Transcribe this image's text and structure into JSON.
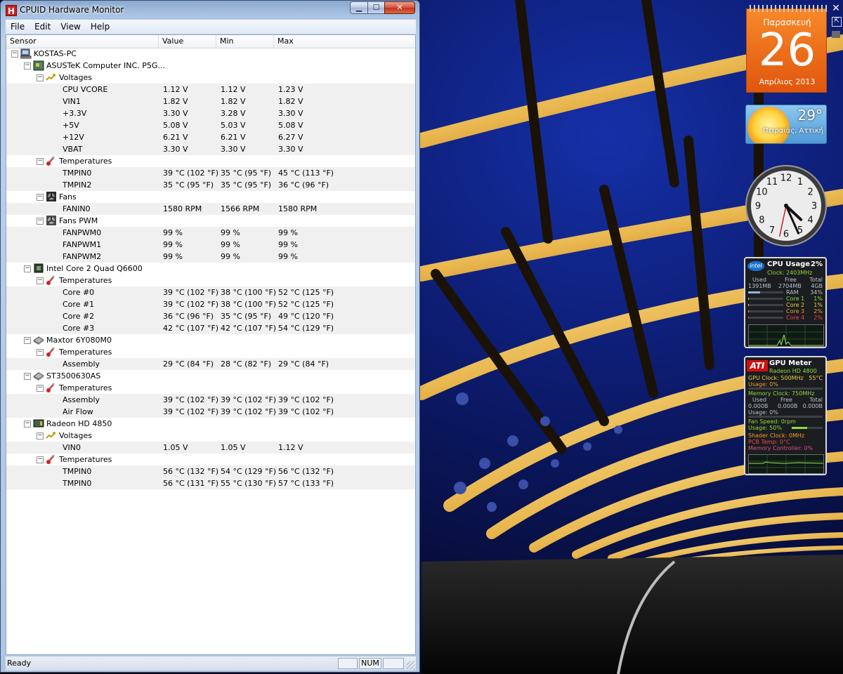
{
  "window": {
    "title": "CPUID Hardware Monitor",
    "app_icon_letter": "H",
    "min_symbol": "▁",
    "max_symbol": "☐",
    "close_symbol": "✕"
  },
  "menu": [
    "File",
    "Edit",
    "View",
    "Help"
  ],
  "columns": [
    "Sensor",
    "Value",
    "Min",
    "Max"
  ],
  "tree": [
    {
      "level": 0,
      "type": "pc",
      "label": "KOSTAS-PC",
      "expand": "minus"
    },
    {
      "level": 1,
      "type": "board",
      "label": "ASUSTeK Computer INC. P5G...",
      "expand": "minus"
    },
    {
      "level": 2,
      "type": "voltage",
      "label": "Voltages",
      "expand": "minus"
    },
    {
      "level": 3,
      "label": "CPU VCORE",
      "value": "1.12 V",
      "min": "1.12 V",
      "max": "1.23 V"
    },
    {
      "level": 3,
      "label": "VIN1",
      "value": "1.82 V",
      "min": "1.82 V",
      "max": "1.82 V"
    },
    {
      "level": 3,
      "label": "+3.3V",
      "value": "3.30 V",
      "min": "3.28 V",
      "max": "3.30 V"
    },
    {
      "level": 3,
      "label": "+5V",
      "value": "5.08 V",
      "min": "5.03 V",
      "max": "5.08 V"
    },
    {
      "level": 3,
      "label": "+12V",
      "value": "6.21 V",
      "min": "6.21 V",
      "max": "6.27 V"
    },
    {
      "level": 3,
      "label": "VBAT",
      "value": "3.30 V",
      "min": "3.30 V",
      "max": "3.30 V"
    },
    {
      "level": 2,
      "type": "temp",
      "label": "Temperatures",
      "expand": "minus"
    },
    {
      "level": 3,
      "label": "TMPIN0",
      "value": "39 °C  (102 °F)",
      "min": "35 °C  (95 °F)",
      "max": "45 °C  (113 °F)"
    },
    {
      "level": 3,
      "label": "TMPIN2",
      "value": "35 °C  (95 °F)",
      "min": "35 °C  (95 °F)",
      "max": "36 °C  (96 °F)"
    },
    {
      "level": 2,
      "type": "fan",
      "label": "Fans",
      "expand": "minus"
    },
    {
      "level": 3,
      "label": "FANIN0",
      "value": "1580 RPM",
      "min": "1566 RPM",
      "max": "1580 RPM"
    },
    {
      "level": 2,
      "type": "fanpwm",
      "label": "Fans PWM",
      "expand": "minus"
    },
    {
      "level": 3,
      "label": "FANPWM0",
      "value": "99 %",
      "min": "99 %",
      "max": "99 %"
    },
    {
      "level": 3,
      "label": "FANPWM1",
      "value": "99 %",
      "min": "99 %",
      "max": "99 %"
    },
    {
      "level": 3,
      "label": "FANPWM2",
      "value": "99 %",
      "min": "99 %",
      "max": "99 %"
    },
    {
      "level": 1,
      "type": "cpu",
      "label": "Intel Core 2 Quad Q6600",
      "expand": "minus"
    },
    {
      "level": 2,
      "type": "temp",
      "label": "Temperatures",
      "expand": "minus"
    },
    {
      "level": 3,
      "label": "Core #0",
      "value": "39 °C  (102 °F)",
      "min": "38 °C  (100 °F)",
      "max": "52 °C  (125 °F)"
    },
    {
      "level": 3,
      "label": "Core #1",
      "value": "39 °C  (102 °F)",
      "min": "38 °C  (100 °F)",
      "max": "52 °C  (125 °F)"
    },
    {
      "level": 3,
      "label": "Core #2",
      "value": "36 °C  (96 °F)",
      "min": "35 °C  (95 °F)",
      "max": "49 °C  (120 °F)"
    },
    {
      "level": 3,
      "label": "Core #3",
      "value": "42 °C  (107 °F)",
      "min": "42 °C  (107 °F)",
      "max": "54 °C  (129 °F)"
    },
    {
      "level": 1,
      "type": "hdd",
      "label": "Maxtor 6Y080M0",
      "expand": "minus"
    },
    {
      "level": 2,
      "type": "temp",
      "label": "Temperatures",
      "expand": "minus"
    },
    {
      "level": 3,
      "label": "Assembly",
      "value": "29 °C  (84 °F)",
      "min": "28 °C  (82 °F)",
      "max": "29 °C  (84 °F)"
    },
    {
      "level": 1,
      "type": "hdd",
      "label": "ST3500630AS",
      "expand": "minus"
    },
    {
      "level": 2,
      "type": "temp",
      "label": "Temperatures",
      "expand": "minus"
    },
    {
      "level": 3,
      "label": "Assembly",
      "value": "39 °C  (102 °F)",
      "min": "39 °C  (102 °F)",
      "max": "39 °C  (102 °F)"
    },
    {
      "level": 3,
      "label": "Air Flow",
      "value": "39 °C  (102 °F)",
      "min": "39 °C  (102 °F)",
      "max": "39 °C  (102 °F)"
    },
    {
      "level": 1,
      "type": "gpu",
      "label": "Radeon HD 4850",
      "expand": "minus"
    },
    {
      "level": 2,
      "type": "voltage",
      "label": "Voltages",
      "expand": "minus"
    },
    {
      "level": 3,
      "label": "VIN0",
      "value": "1.05 V",
      "min": "1.05 V",
      "max": "1.12 V"
    },
    {
      "level": 2,
      "type": "temp",
      "label": "Temperatures",
      "expand": "minus"
    },
    {
      "level": 3,
      "label": "TMPIN0",
      "value": "56 °C  (132 °F)",
      "min": "54 °C  (129 °F)",
      "max": "56 °C  (132 °F)"
    },
    {
      "level": 3,
      "label": "TMPIN0",
      "value": "56 °C  (131 °F)",
      "min": "55 °C  (130 °F)",
      "max": "57 °C  (133 °F)"
    }
  ],
  "status": {
    "text": "Ready",
    "num": "NUM"
  },
  "gadgets": {
    "close_symbol": "✕",
    "tools_symbol": "⇱",
    "calendar": {
      "day_name": "Παρασκευή",
      "day": "26",
      "month_year": "Απρίλιος 2013"
    },
    "weather": {
      "temp": "29°",
      "location": "Πειραιάς, Αττική"
    },
    "clock": {
      "numerals": [
        "12",
        "1",
        "2",
        "3",
        "4",
        "5",
        "6",
        "7",
        "8",
        "9",
        "10",
        "11"
      ],
      "hour": 4,
      "minute": 26,
      "second": 32
    },
    "cpu": {
      "logo": "intel",
      "title": "CPU Usage",
      "percent": "2%",
      "clock": "Clock: 2403MHz",
      "headers": [
        "Used",
        "Free",
        "Total"
      ],
      "mem": [
        "1391MB",
        "2704MB",
        "4GB"
      ],
      "ram_label": "RAM",
      "ram_pct": "34%",
      "ram_fill": 0.34,
      "cores": [
        {
          "name": "Core 1",
          "pct": "1%",
          "fill": 0.01
        },
        {
          "name": "Core 2",
          "pct": "1%",
          "fill": 0.01
        },
        {
          "name": "Core 3",
          "pct": "2%",
          "fill": 0.02
        },
        {
          "name": "Core 4",
          "pct": "2%",
          "fill": 0.02
        }
      ],
      "colors": {
        "core1": "#8fdc3c",
        "core2": "#e8d23a",
        "core3": "#f2a12e",
        "core4": "#ee4a4a"
      }
    },
    "gpu": {
      "logo": "ATI",
      "title": "GPU Meter",
      "model": "Radeon HD 4800",
      "gpu_clock": "GPU Clock: 500MHz",
      "gpu_temp": "55°C",
      "gpu_usage": "Usage: 0%",
      "mem_clock": "Memory Clock: 750MHz",
      "headers": [
        "Used",
        "Free",
        "Total"
      ],
      "mem": [
        "0.000B",
        "0.000B",
        "0.000B"
      ],
      "mem_usage": "Usage: 0%",
      "fan_speed": "Fan Speed: 0rpm",
      "fan_usage": "Usage: 50%",
      "fan_fill": 0.5,
      "shader_clock": "Shader Clock: 0MHz",
      "pcb_temp": "PCB Temp: 0°C",
      "mem_controller": "Memory Controller: 0%"
    }
  }
}
